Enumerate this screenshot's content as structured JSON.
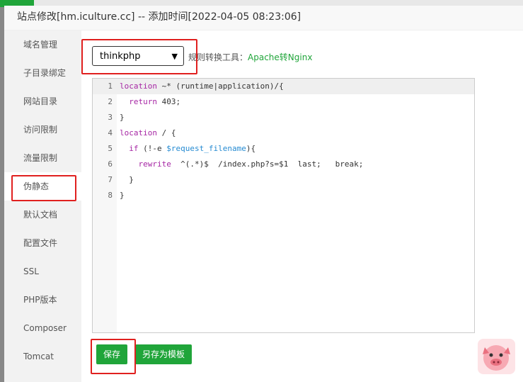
{
  "title": "站点修改[hm.iculture.cc] -- 添加时间[2022-04-05 08:23:06]",
  "sidebar": {
    "items": [
      "域名管理",
      "子目录绑定",
      "网站目录",
      "访问限制",
      "流量限制",
      "伪静态",
      "默认文档",
      "配置文件",
      "SSL",
      "PHP版本",
      "Composer",
      "Tomcat"
    ],
    "active": "伪静态"
  },
  "rewrite": {
    "template_select": "thinkphp",
    "tool_label": "规则转换工具：",
    "tool_link": "Apache转Nginx"
  },
  "editor": {
    "lines": [
      "location ~* (runtime|application)/{",
      "  return 403;",
      "}",
      "location / {",
      "  if (!-e $request_filename){",
      "    rewrite  ^(.*)$  /index.php?s=$1  last;   break;",
      "  }",
      "}"
    ]
  },
  "buttons": {
    "save": "保存",
    "save_template": "另存为模板"
  },
  "colors": {
    "accent": "#20a53a",
    "highlight": "#e0201f"
  }
}
